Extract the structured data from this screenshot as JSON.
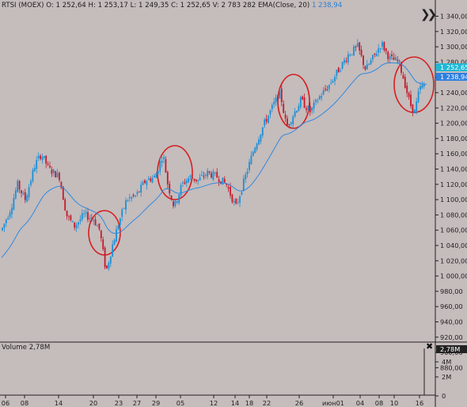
{
  "header": {
    "symbol": "RTSI (MOEX)",
    "open": "O: 1 252,64",
    "high": "H: 1 253,17",
    "low": "L: 1 249,35",
    "close": "C: 1 252,65",
    "volume": "V: 2 783 282",
    "ema_label": "EMA(Close, 20)",
    "ema_value": "1 238,94"
  },
  "price_axis": {
    "ticks": [
      "1 340,00",
      "1 320,00",
      "1 300,00",
      "1 280,00",
      "1 260,00",
      "1 240,00",
      "1 220,00",
      "1 200,00",
      "1 180,00",
      "1 160,00",
      "1 140,00",
      "1 120,00",
      "1 100,00",
      "1 080,00",
      "1 060,00",
      "1 040,00",
      "1 020,00",
      "1 000,00",
      "980,00",
      "960,00",
      "940,00",
      "920,00",
      "900,00",
      "880,00"
    ],
    "last_price_label": "1 252,65",
    "ema_price_label": "1 238,94"
  },
  "time_axis": {
    "labels": [
      "06",
      "08",
      "14",
      "20",
      "23",
      "27",
      "29",
      "05",
      "12",
      "14",
      "18",
      "22",
      "26",
      "июн01",
      "04",
      "08",
      "10",
      "16"
    ]
  },
  "volume_pane": {
    "label": "Volume 2,78M",
    "value_label": "2,78M",
    "ticks": [
      "4M",
      "2M",
      "0"
    ]
  },
  "colors": {
    "background": "#c5bcbc",
    "bull_candle": "#1a8fd8",
    "bear_candle": "#c41a2a",
    "ema_line": "#2e8ae0",
    "last_price_tag": "#1fb9d6",
    "ema_tag": "#2e7fe0",
    "circle": "#d42020"
  },
  "icons": {
    "fast_forward": "fast-forward-icon",
    "close_volume": "close-icon"
  }
}
